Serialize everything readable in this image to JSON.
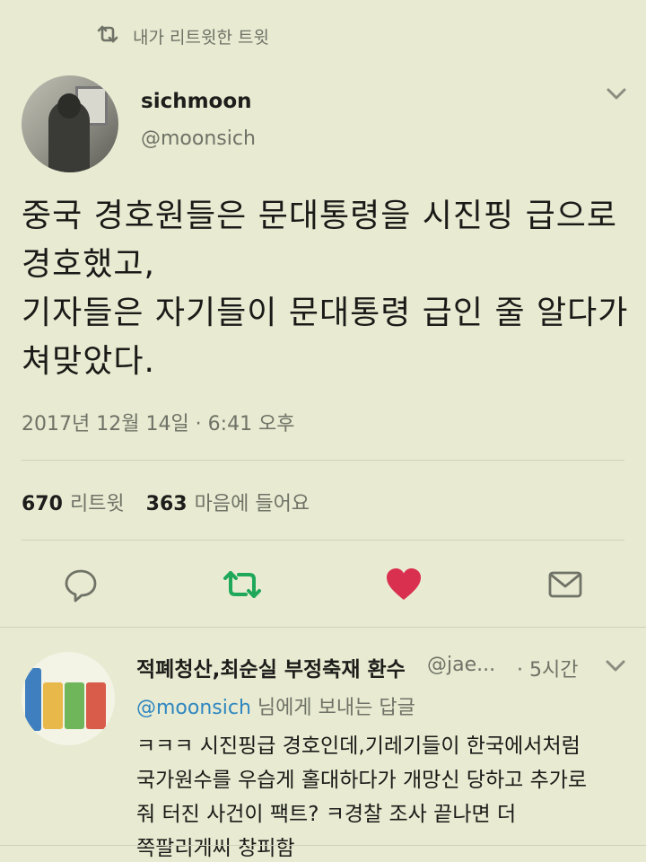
{
  "context": {
    "label": "내가 리트윗한 트윗",
    "icon": "retweet-icon"
  },
  "tweet": {
    "display_name": "sichmoon",
    "handle": "@moonsich",
    "text": "중국 경호원들은 문대통령을 시진핑 급으로\n경호했고,\n기자들은 자기들이 문대통령 급인 줄 알다가\n쳐맞았다.",
    "timestamp": "2017년 12월 14일 · 6:41 오후"
  },
  "stats": {
    "retweets_count": "670",
    "retweets_label": "리트윗",
    "likes_count": "363",
    "likes_label": "마음에 들어요"
  },
  "actions": {
    "reply_icon": "reply-icon",
    "retweet_icon": "retweet-icon",
    "like_icon": "heart-icon",
    "dm_icon": "envelope-icon"
  },
  "colors": {
    "background": "#e8ebd1",
    "retweet_active": "#1fa85a",
    "like_active": "#d9304f",
    "mention": "#2e86c1",
    "muted": "#6f7266"
  },
  "reply": {
    "display_name": "적폐청산,최순실 부정축재 환수",
    "handle": "@jae...",
    "time": "· 5시간",
    "replying_to_mention": "@moonsich",
    "replying_to_suffix": " 님에게 보내는 답글",
    "text": "ㅋㅋㅋ 시진핑급 경호인데,기레기들이 한국에서처럼\n국가원수를 우습게 홀대하다가 개망신 당하고 추가로\n줘 터진 사건이 팩트? ㅋ경찰 조사 끝나면 더\n쪽팔리게씨 창피함"
  }
}
